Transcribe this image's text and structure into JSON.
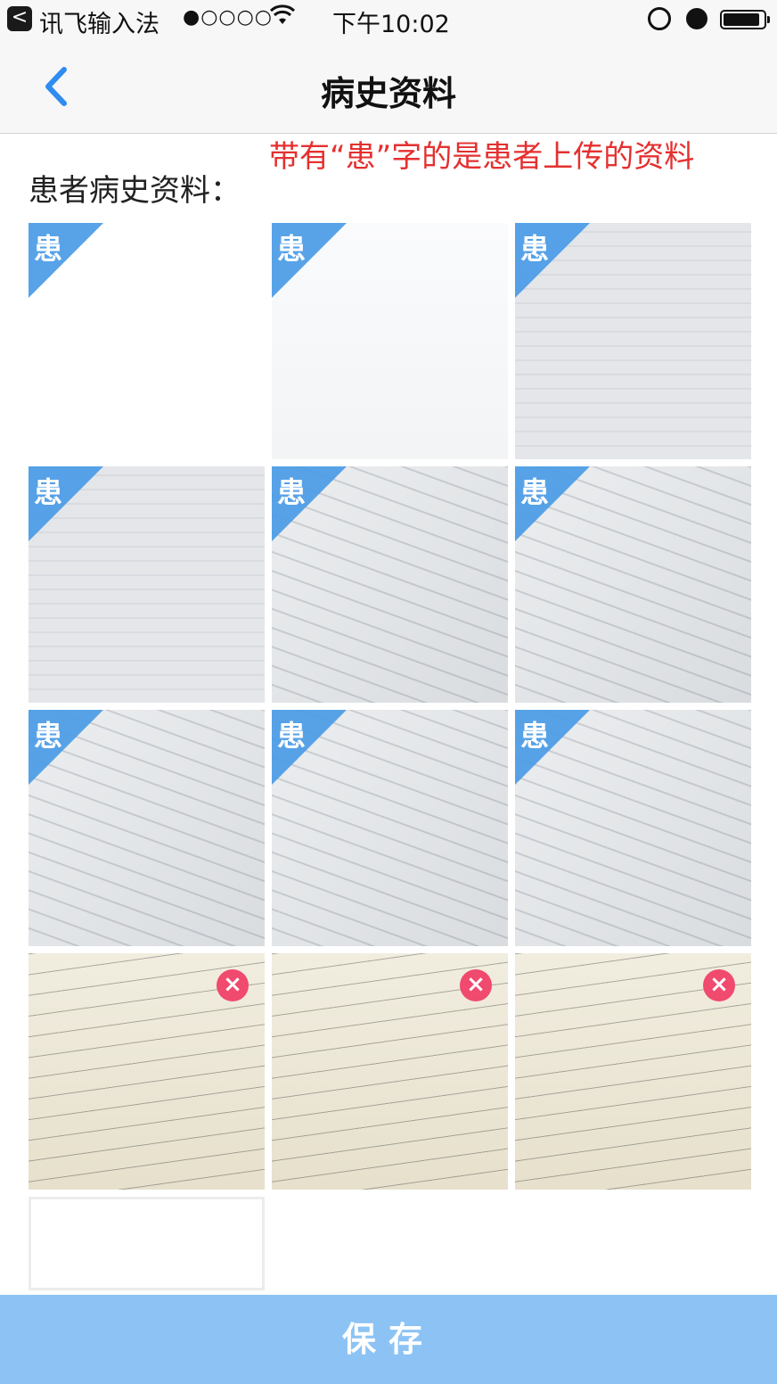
{
  "status": {
    "back_app_glyph": "<",
    "app": "讯飞输入法",
    "signal": "●○○○○",
    "time": "下午10:02"
  },
  "nav": {
    "title": "病史资料"
  },
  "note": "带有“患”字的是患者上传的资料",
  "section_title": "患者病史资料：",
  "badge_label": "患",
  "delete_glyph": "×",
  "tiles": [
    {
      "badge": true,
      "deletable": false,
      "kind": "app"
    },
    {
      "badge": true,
      "deletable": false,
      "kind": "form"
    },
    {
      "badge": true,
      "deletable": false,
      "kind": "screen"
    },
    {
      "badge": true,
      "deletable": false,
      "kind": "screen"
    },
    {
      "badge": true,
      "deletable": false,
      "kind": "board"
    },
    {
      "badge": true,
      "deletable": false,
      "kind": "board"
    },
    {
      "badge": true,
      "deletable": false,
      "kind": "board"
    },
    {
      "badge": true,
      "deletable": false,
      "kind": "board"
    },
    {
      "badge": true,
      "deletable": false,
      "kind": "board"
    },
    {
      "badge": false,
      "deletable": true,
      "kind": "notebook"
    },
    {
      "badge": false,
      "deletable": true,
      "kind": "notebook"
    },
    {
      "badge": false,
      "deletable": true,
      "kind": "notebook"
    },
    {
      "badge": false,
      "deletable": false,
      "kind": "empty"
    }
  ],
  "save_label": "保存",
  "colors": {
    "accent": "#4a9be6",
    "note": "#e53030",
    "delete": "#f04a6e",
    "save_bar": "#8cc3f4"
  }
}
